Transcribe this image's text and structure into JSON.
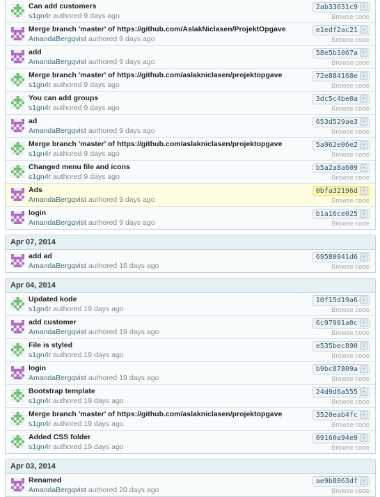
{
  "labels": {
    "authored": "authored",
    "browse": "Browse code"
  },
  "avatars": {
    "green-identicon": {
      "color": "#6dbe6d"
    },
    "purple-identicon": {
      "color": "#b06ac0"
    }
  },
  "groups": [
    {
      "date": "",
      "commits": [
        {
          "message": "Can add customers",
          "author": "s1gn4r",
          "age": "9 days ago",
          "sha": "2ab33631c9",
          "avatar": "green-identicon",
          "highlighted": false
        },
        {
          "message": "Merge branch 'master' of https://github.com/AslakNiclasen/ProjektOpgave",
          "author": "AmandaBergqvist",
          "age": "9 days ago",
          "sha": "e1edf2ac21",
          "avatar": "purple-identicon",
          "highlighted": false
        },
        {
          "message": "add",
          "author": "AmandaBergqvist",
          "age": "9 days ago",
          "sha": "58e5b1067a",
          "avatar": "purple-identicon",
          "highlighted": false
        },
        {
          "message": "Merge branch 'master' of https://github.com/aslakniclasen/projektopgave",
          "author": "s1gn4r",
          "age": "9 days ago",
          "sha": "72e884168e",
          "avatar": "green-identicon",
          "highlighted": false
        },
        {
          "message": "You can add groups",
          "author": "s1gn4r",
          "age": "9 days ago",
          "sha": "3dc5c4be0a",
          "avatar": "green-identicon",
          "highlighted": false
        },
        {
          "message": "ad",
          "author": "AmandaBergqvist",
          "age": "9 days ago",
          "sha": "653d529ae3",
          "avatar": "purple-identicon",
          "highlighted": false
        },
        {
          "message": "Merge branch 'master' of https://github.com/aslakniclasen/projektopgave",
          "author": "s1gn4r",
          "age": "9 days ago",
          "sha": "5a962e06e2",
          "avatar": "green-identicon",
          "highlighted": false
        },
        {
          "message": "Changed menu file and icons",
          "author": "s1gn4r",
          "age": "9 days ago",
          "sha": "b5a2a8a609",
          "avatar": "green-identicon",
          "highlighted": false
        },
        {
          "message": "Ads",
          "author": "AmandaBergqvist",
          "age": "9 days ago",
          "sha": "0bfa32196d",
          "avatar": "purple-identicon",
          "highlighted": true
        },
        {
          "message": "login",
          "author": "AmandaBergqvist",
          "age": "9 days ago",
          "sha": "b1a16ce025",
          "avatar": "purple-identicon",
          "highlighted": false
        }
      ]
    },
    {
      "date": "Apr 07, 2014",
      "commits": [
        {
          "message": "add ad",
          "author": "AmandaBergqvist",
          "age": "16 days ago",
          "sha": "69580941d6",
          "avatar": "purple-identicon",
          "highlighted": false
        }
      ]
    },
    {
      "date": "Apr 04, 2014",
      "commits": [
        {
          "message": "Updated kode",
          "author": "s1gn4r",
          "age": "19 days ago",
          "sha": "10f15d19a6",
          "avatar": "green-identicon",
          "highlighted": false
        },
        {
          "message": "add customer",
          "author": "AmandaBergqvist",
          "age": "19 days ago",
          "sha": "6c97991a0c",
          "avatar": "purple-identicon",
          "highlighted": false
        },
        {
          "message": "File is styled",
          "author": "s1gn4r",
          "age": "19 days ago",
          "sha": "e535bec890",
          "avatar": "green-identicon",
          "highlighted": false
        },
        {
          "message": "login",
          "author": "AmandaBergqvist",
          "age": "19 days ago",
          "sha": "b9bc87809a",
          "avatar": "purple-identicon",
          "highlighted": false
        },
        {
          "message": "Bootstrap template",
          "author": "s1gn4r",
          "age": "19 days ago",
          "sha": "24d9d6a555",
          "avatar": "green-identicon",
          "highlighted": false
        },
        {
          "message": "Merge branch 'master' of https://github.com/aslakniclasen/projektopgave",
          "author": "s1gn4r",
          "age": "19 days ago",
          "sha": "3520eab4fc",
          "avatar": "green-identicon",
          "highlighted": false
        },
        {
          "message": "Added CSS folder",
          "author": "s1gn4r",
          "age": "19 days ago",
          "sha": "09160a94e9",
          "avatar": "green-identicon",
          "highlighted": false
        }
      ]
    },
    {
      "date": "Apr 03, 2014",
      "commits": [
        {
          "message": "Renamed",
          "author": "AmandaBergqvist",
          "age": "20 days ago",
          "sha": "ae9b8063df",
          "avatar": "purple-identicon",
          "highlighted": false
        }
      ]
    }
  ]
}
